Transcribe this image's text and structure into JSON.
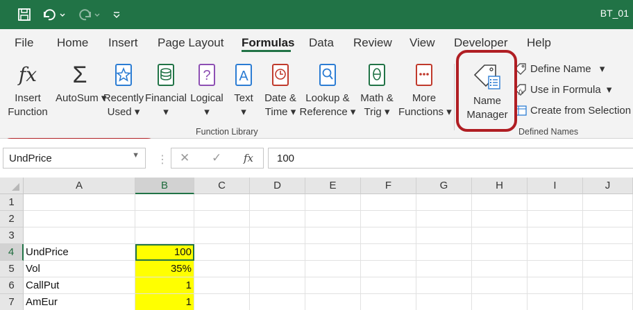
{
  "window": {
    "title": "BT_01"
  },
  "ribbon_tabs": [
    "File",
    "Home",
    "Insert",
    "Page Layout",
    "Formulas",
    "Data",
    "Review",
    "View",
    "Developer",
    "Help"
  ],
  "function_library": {
    "label": "Function Library",
    "buttons": [
      {
        "line1": "Insert",
        "line2": "Function"
      },
      {
        "line1": "AutoSum",
        "line2": ""
      },
      {
        "line1": "Recently",
        "line2": "Used"
      },
      {
        "line1": "Financial",
        "line2": ""
      },
      {
        "line1": "Logical",
        "line2": ""
      },
      {
        "line1": "Text",
        "line2": ""
      },
      {
        "line1": "Date &",
        "line2": "Time"
      },
      {
        "line1": "Lookup &",
        "line2": "Reference"
      },
      {
        "line1": "Math &",
        "line2": "Trig"
      },
      {
        "line1": "More",
        "line2": "Functions"
      }
    ]
  },
  "defined_names": {
    "label": "Defined Names",
    "name_manager": {
      "line1": "Name",
      "line2": "Manager"
    },
    "define_name": "Define Name",
    "use_in_formula": "Use in Formula",
    "create_from_selection": "Create from Selection"
  },
  "formula_bar": {
    "name_box": "UndPrice",
    "fx_symbol": "fx",
    "formula": "100"
  },
  "columns": [
    "A",
    "B",
    "C",
    "D",
    "E",
    "F",
    "G",
    "H",
    "I",
    "J"
  ],
  "rows": [
    {
      "num": "1",
      "a": "",
      "b": ""
    },
    {
      "num": "2",
      "a": "",
      "b": ""
    },
    {
      "num": "3",
      "a": "",
      "b": ""
    },
    {
      "num": "4",
      "a": "UndPrice",
      "b": "100"
    },
    {
      "num": "5",
      "a": "Vol",
      "b": "35%"
    },
    {
      "num": "6",
      "a": "CallPut",
      "b": "1"
    },
    {
      "num": "7",
      "a": "AmEur",
      "b": "1"
    }
  ],
  "colors": {
    "accent": "#217346",
    "highlight": "#ffff00",
    "annotation": "#b01e23"
  }
}
